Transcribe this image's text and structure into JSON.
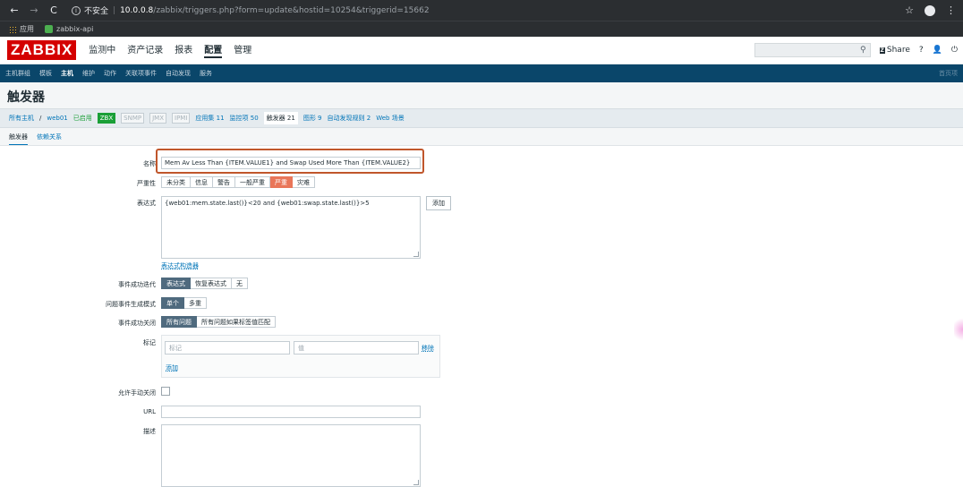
{
  "browser": {
    "insecure_label": "不安全",
    "url_host": "10.0.0.8",
    "url_path": "/zabbix/triggers.php?form=update&hostid=10254&triggerid=15662",
    "bookmarks": [
      "应用",
      "zabbix-api"
    ]
  },
  "header": {
    "logo": "ZABBIX",
    "menu": [
      "监测中",
      "资产记录",
      "报表",
      "配置",
      "管理"
    ],
    "active_menu": "配置",
    "share_label": "Share",
    "help": "?"
  },
  "submenu": {
    "items": [
      "主机群组",
      "模板",
      "主机",
      "维护",
      "动作",
      "关联项事件",
      "自动发现",
      "服务"
    ],
    "active": "主机",
    "right_text": "首页项"
  },
  "page_title": "触发器",
  "breadcrumbs": {
    "all_hosts": "所有主机",
    "separator": "/",
    "host": "web01",
    "status": "已启用",
    "tags": [
      "ZBX",
      "SNMP",
      "JMX",
      "IPMI"
    ],
    "links": [
      "应用集 11",
      "监控项 50",
      "触发器 21",
      "图形 9",
      "自动发现规则 2",
      "Web 场景"
    ],
    "current": "触发器 21"
  },
  "tabs": [
    "触发器",
    "依赖关系"
  ],
  "form": {
    "name_label": "名称",
    "name_value": "Mem Av Less Than {ITEM.VALUE1} and Swap Used More Than {ITEM.VALUE2}",
    "severity_label": "严重性",
    "severity_options": [
      "未分类",
      "信息",
      "警告",
      "一般严重",
      "严重",
      "灾难"
    ],
    "severity_selected": "严重",
    "expression_label": "表达式",
    "expression_value": "{web01:mem.state.last()}<20 and {web01:swap.state.last()}>5",
    "add_button": "添加",
    "expression_builder": "表达式构造器",
    "ok_event_gen_label": "事件成功迭代",
    "ok_event_gen_options": [
      "表达式",
      "恢复表达式",
      "无"
    ],
    "problem_mode_label": "问题事件生成模式",
    "problem_mode_options": [
      "单个",
      "多重"
    ],
    "ok_close_label": "事件成功关闭",
    "ok_close_options": [
      "所有问题",
      "所有问题如果标签值匹配"
    ],
    "tags_label": "标记",
    "tag_placeholder": "标记",
    "value_placeholder": "值",
    "remove_link": "移除",
    "add_link": "添加",
    "manual_close_label": "允许手动关闭",
    "url_label": "URL",
    "description_label": "描述"
  },
  "colors": {
    "brand_red": "#d40000",
    "submenu_bg": "#0a466a",
    "selected_segment": "#4f6a7e",
    "severity_high": "#e97659",
    "highlight_box": "#c0562b"
  }
}
